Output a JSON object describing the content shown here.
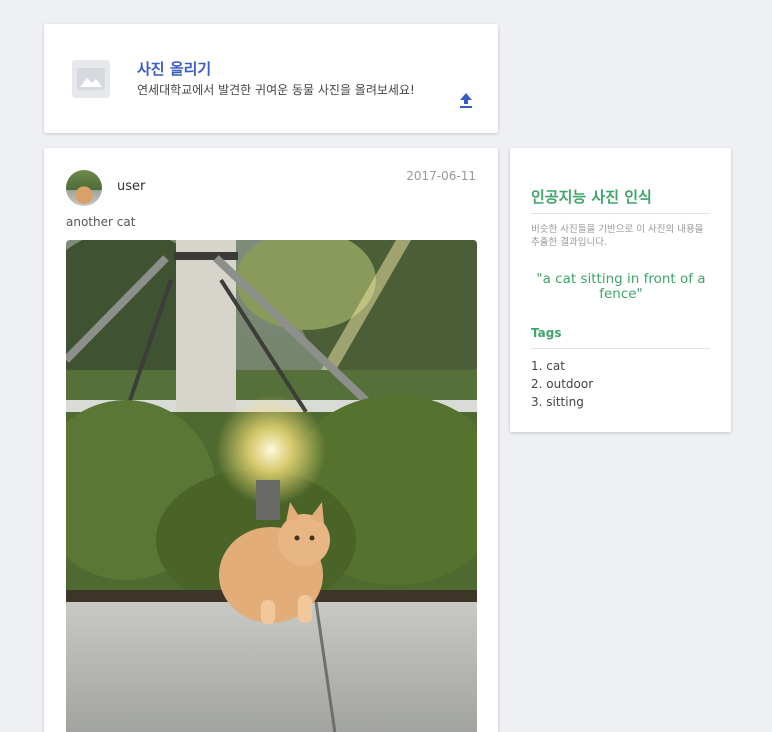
{
  "upload": {
    "title": "사진 올리기",
    "description": "연세대학교에서 발견한 귀여운 동물 사진을 올려보세요!"
  },
  "post": {
    "username": "user",
    "date": "2017-06-11",
    "caption": "another cat"
  },
  "ai": {
    "title": "인공지능 사진 인식",
    "description": "비슷한 사진들을 기반으로 이 사진의 내용을 추출한 결과입니다.",
    "quote": "\"a cat sitting in front of a fence\"",
    "tags_title": "Tags",
    "tags": [
      "1. cat",
      "2. outdoor",
      "3. sitting"
    ]
  },
  "colors": {
    "accent_blue": "#3b5bc7",
    "accent_green": "#3fa56a",
    "background": "#eef0f3"
  },
  "icons": {
    "thumbnail": "image-placeholder-icon",
    "upload": "upload-arrow-icon"
  }
}
